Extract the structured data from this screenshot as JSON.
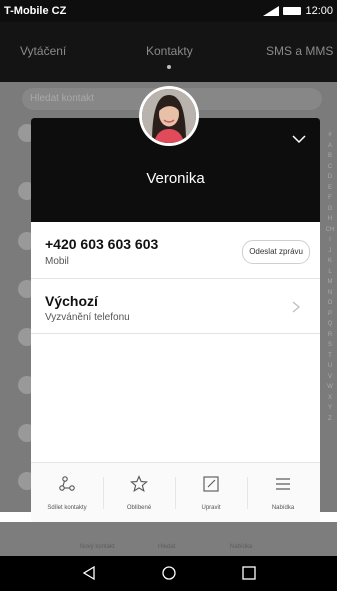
{
  "status_bar": {
    "carrier": "T-Mobile CZ",
    "time": "12:00"
  },
  "tabs": [
    {
      "label": "Vytáčení"
    },
    {
      "label": "Kontakty"
    },
    {
      "label": "SMS a MMS"
    }
  ],
  "search": {
    "placeholder": "Hledat kontakt"
  },
  "alphabet_index": [
    "#",
    "A",
    "B",
    "C",
    "D",
    "E",
    "F",
    "G",
    "H",
    "CH",
    "I",
    "J",
    "K",
    "L",
    "M",
    "N",
    "O",
    "P",
    "Q",
    "R",
    "S",
    "T",
    "U",
    "V",
    "W",
    "X",
    "Y",
    "Z"
  ],
  "background_actions": [
    {
      "label": "Nový kontakt"
    },
    {
      "label": "Hledat"
    },
    {
      "label": "Nabídka"
    }
  ],
  "contact": {
    "name": "Veronika",
    "phone": {
      "number": "+420 603 603 603",
      "type": "Mobil",
      "message_button": "Odeslat zprávu"
    },
    "ringtone": {
      "title": "Výchozí",
      "subtitle": "Vyzvánění telefonu"
    }
  },
  "card_actions": [
    {
      "label": "Sdílet kontakty",
      "icon": "share-icon"
    },
    {
      "label": "Oblíbené",
      "icon": "star-icon"
    },
    {
      "label": "Upravit",
      "icon": "edit-icon"
    },
    {
      "label": "Nabídka",
      "icon": "menu-icon"
    }
  ],
  "nav_icons": [
    "back-icon",
    "home-icon",
    "recents-icon"
  ]
}
